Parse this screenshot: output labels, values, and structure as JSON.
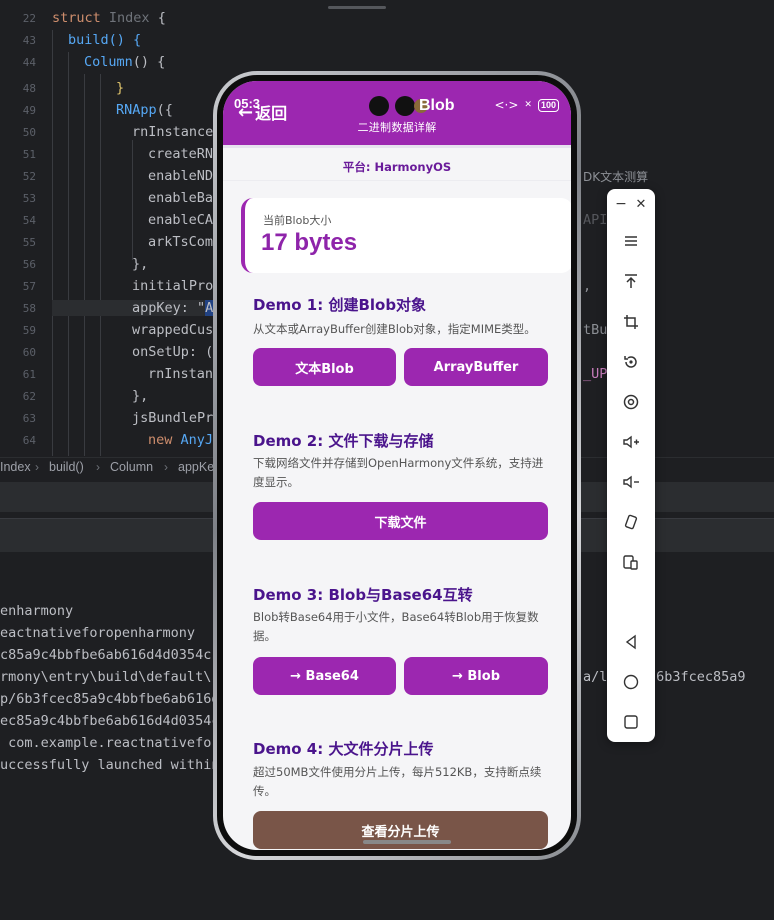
{
  "ide": {
    "gutter": [
      "22",
      "43",
      "44",
      "48",
      "49",
      "50",
      "51",
      "52",
      "53",
      "54",
      "55",
      "56",
      "57",
      "58",
      "59",
      "60",
      "61",
      "62",
      "63",
      "64"
    ],
    "code": {
      "l1_kw": "struct",
      "l1_name": "Index",
      "l1_brace": " {",
      "l2": "build() {",
      "l3_name": "Column",
      "l3_rest": "() {",
      "l4": "}",
      "l5_name": "RNApp",
      "l5_rest": "({",
      "l6": "rnInstance",
      "l7": "createRN",
      "l8": "enableND",
      "l9": "enableBa",
      "l10": "enableCA",
      "l11": "arkTsCom",
      "l12": "},",
      "l13": "initialPro",
      "l14_a": "appKey: \"",
      "l14_b": "A",
      "l15": "wrappedCus",
      "l16": "onSetUp: (",
      "l17": "rnInstan",
      "l18": "},",
      "l19": "jsBundlePr",
      "l20_kw": "new",
      "l20_name": "AnyJ"
    },
    "right_snippets": [
      "DK文本测算",
      "API",
      ",",
      "tBu",
      "_UP"
    ],
    "breadcrumb": [
      "Index",
      "build()",
      "Column",
      "appKe"
    ],
    "logs": [
      "enharmony",
      "eactnativeforopenharmony",
      "c85a9c4bbfbe6ab616d4d0354c",
      "rmony\\entry\\build\\default\\",
      "p/6b3fcec85a9c4bbfbe6ab616d",
      "ec85a9c4bbfbe6ab616d4d0354c",
      " com.example.reactnativefor",
      "uccessfully launched within"
    ],
    "log_right": "a/l   mp/6b3fcec85a9"
  },
  "toolbar": {
    "minimize": "−",
    "close": "✕",
    "items": [
      "menu-icon",
      "pin-top-icon",
      "crop-icon",
      "rotate-icon",
      "record-icon",
      "volume-up-icon",
      "volume-down-icon",
      "shake-icon",
      "device-switch-icon",
      "back-nav-icon",
      "home-nav-icon",
      "recents-nav-icon"
    ]
  },
  "app": {
    "status_time": "05:3",
    "back_label": "返回",
    "title": "Blob",
    "subtitle": "二进制数据详解",
    "battery": "100",
    "platform": "平台: HarmonyOS",
    "size_label": "当前Blob大小",
    "size_value": "17 bytes",
    "demos": [
      {
        "title": "Demo 1: 创建Blob对象",
        "desc": "从文本或ArrayBuffer创建Blob对象，指定MIME类型。",
        "buttons": [
          "文本Blob",
          "ArrayBuffer"
        ]
      },
      {
        "title": "Demo 2: 文件下载与存储",
        "desc": "下载网络文件并存储到OpenHarmony文件系统，支持进度显示。",
        "buttons": [
          "下载文件"
        ]
      },
      {
        "title": "Demo 3: Blob与Base64互转",
        "desc": "Blob转Base64用于小文件，Base64转Blob用于恢复数据。",
        "buttons": [
          "→ Base64",
          "→ Blob"
        ]
      },
      {
        "title": "Demo 4: 大文件分片上传",
        "desc": "超过50MB文件使用分片上传，每片512KB，支持断点续传。",
        "buttons": [
          "查看分片上传"
        ]
      }
    ],
    "colors": {
      "primary": "#9c27b0",
      "title": "#4a148c",
      "brown_button": "#795548"
    }
  }
}
